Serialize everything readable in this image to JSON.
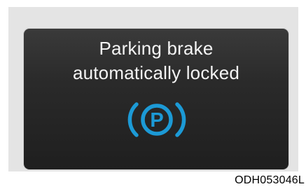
{
  "display": {
    "message_line1": "Parking brake",
    "message_line2": "automatically locked",
    "icon": "parking-brake-icon",
    "icon_letter": "P",
    "icon_color": "#1c9ad6",
    "background_color": "#262626"
  },
  "figure_code": "ODH053046L"
}
